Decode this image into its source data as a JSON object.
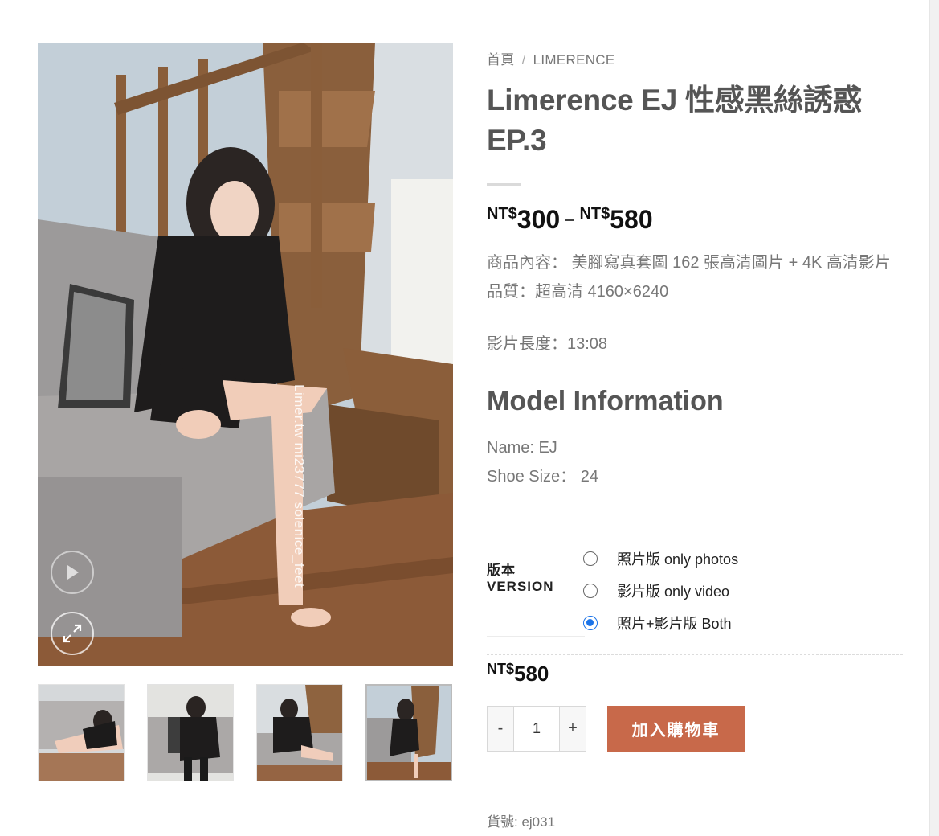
{
  "breadcrumb": {
    "home": "首頁",
    "separator": "/",
    "category": "LIMERENCE"
  },
  "product": {
    "title": "Limerence EJ 性感黑絲誘惑 EP.3",
    "price_min_currency": "NT$",
    "price_min": "300",
    "price_dash": "–",
    "price_max_currency": "NT$",
    "price_max": "580",
    "description": {
      "line1": "商品內容： 美腳寫真套圖 162 張高清圖片 + 4K 高清影片",
      "line2": "品質：超高清 4160×6240",
      "line3": "影片長度：13:08"
    }
  },
  "model": {
    "heading": "Model Information",
    "name": "Name: EJ",
    "shoe_size": "Shoe Size： 24"
  },
  "variation": {
    "label_line1": "版本",
    "label_line2": "VERSION",
    "options": [
      {
        "label": "照片版 only photos",
        "checked": false
      },
      {
        "label": "影片版 only video",
        "checked": false
      },
      {
        "label": "照片+影片版 Both",
        "checked": true
      }
    ]
  },
  "selected_price": {
    "currency": "NT$",
    "amount": "580"
  },
  "cart": {
    "quantity": "1",
    "minus": "-",
    "plus": "+",
    "add_label": "加入購物車"
  },
  "sku": "貨號: ej031",
  "gallery": {
    "watermark": "Limer.tw mi23777 solenice_feet",
    "icons": {
      "play": "play-icon",
      "zoom": "expand-icon"
    }
  },
  "colors": {
    "accent": "#c8694a",
    "radio_checked": "#1a73e8"
  }
}
